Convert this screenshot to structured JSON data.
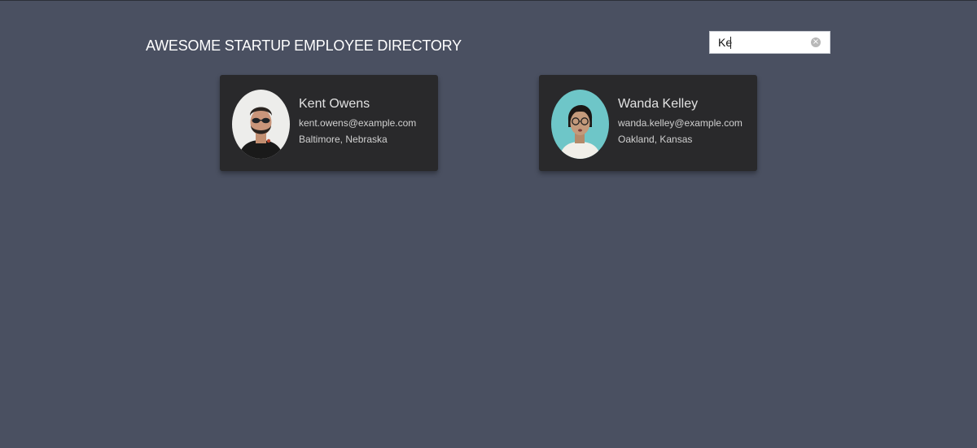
{
  "header": {
    "title": "AWESOME STARTUP EMPLOYEE DIRECTORY"
  },
  "search": {
    "value": "Ke",
    "clear_icon": "clear-circle-icon"
  },
  "colors": {
    "background": "#4a5061",
    "card": "#29292b",
    "title": "#ffffff"
  },
  "employees": [
    {
      "name": "Kent Owens",
      "email": "kent.owens@example.com",
      "location": "Baltimore, Nebraska"
    },
    {
      "name": "Wanda Kelley",
      "email": "wanda.kelley@example.com",
      "location": "Oakland, Kansas"
    }
  ]
}
